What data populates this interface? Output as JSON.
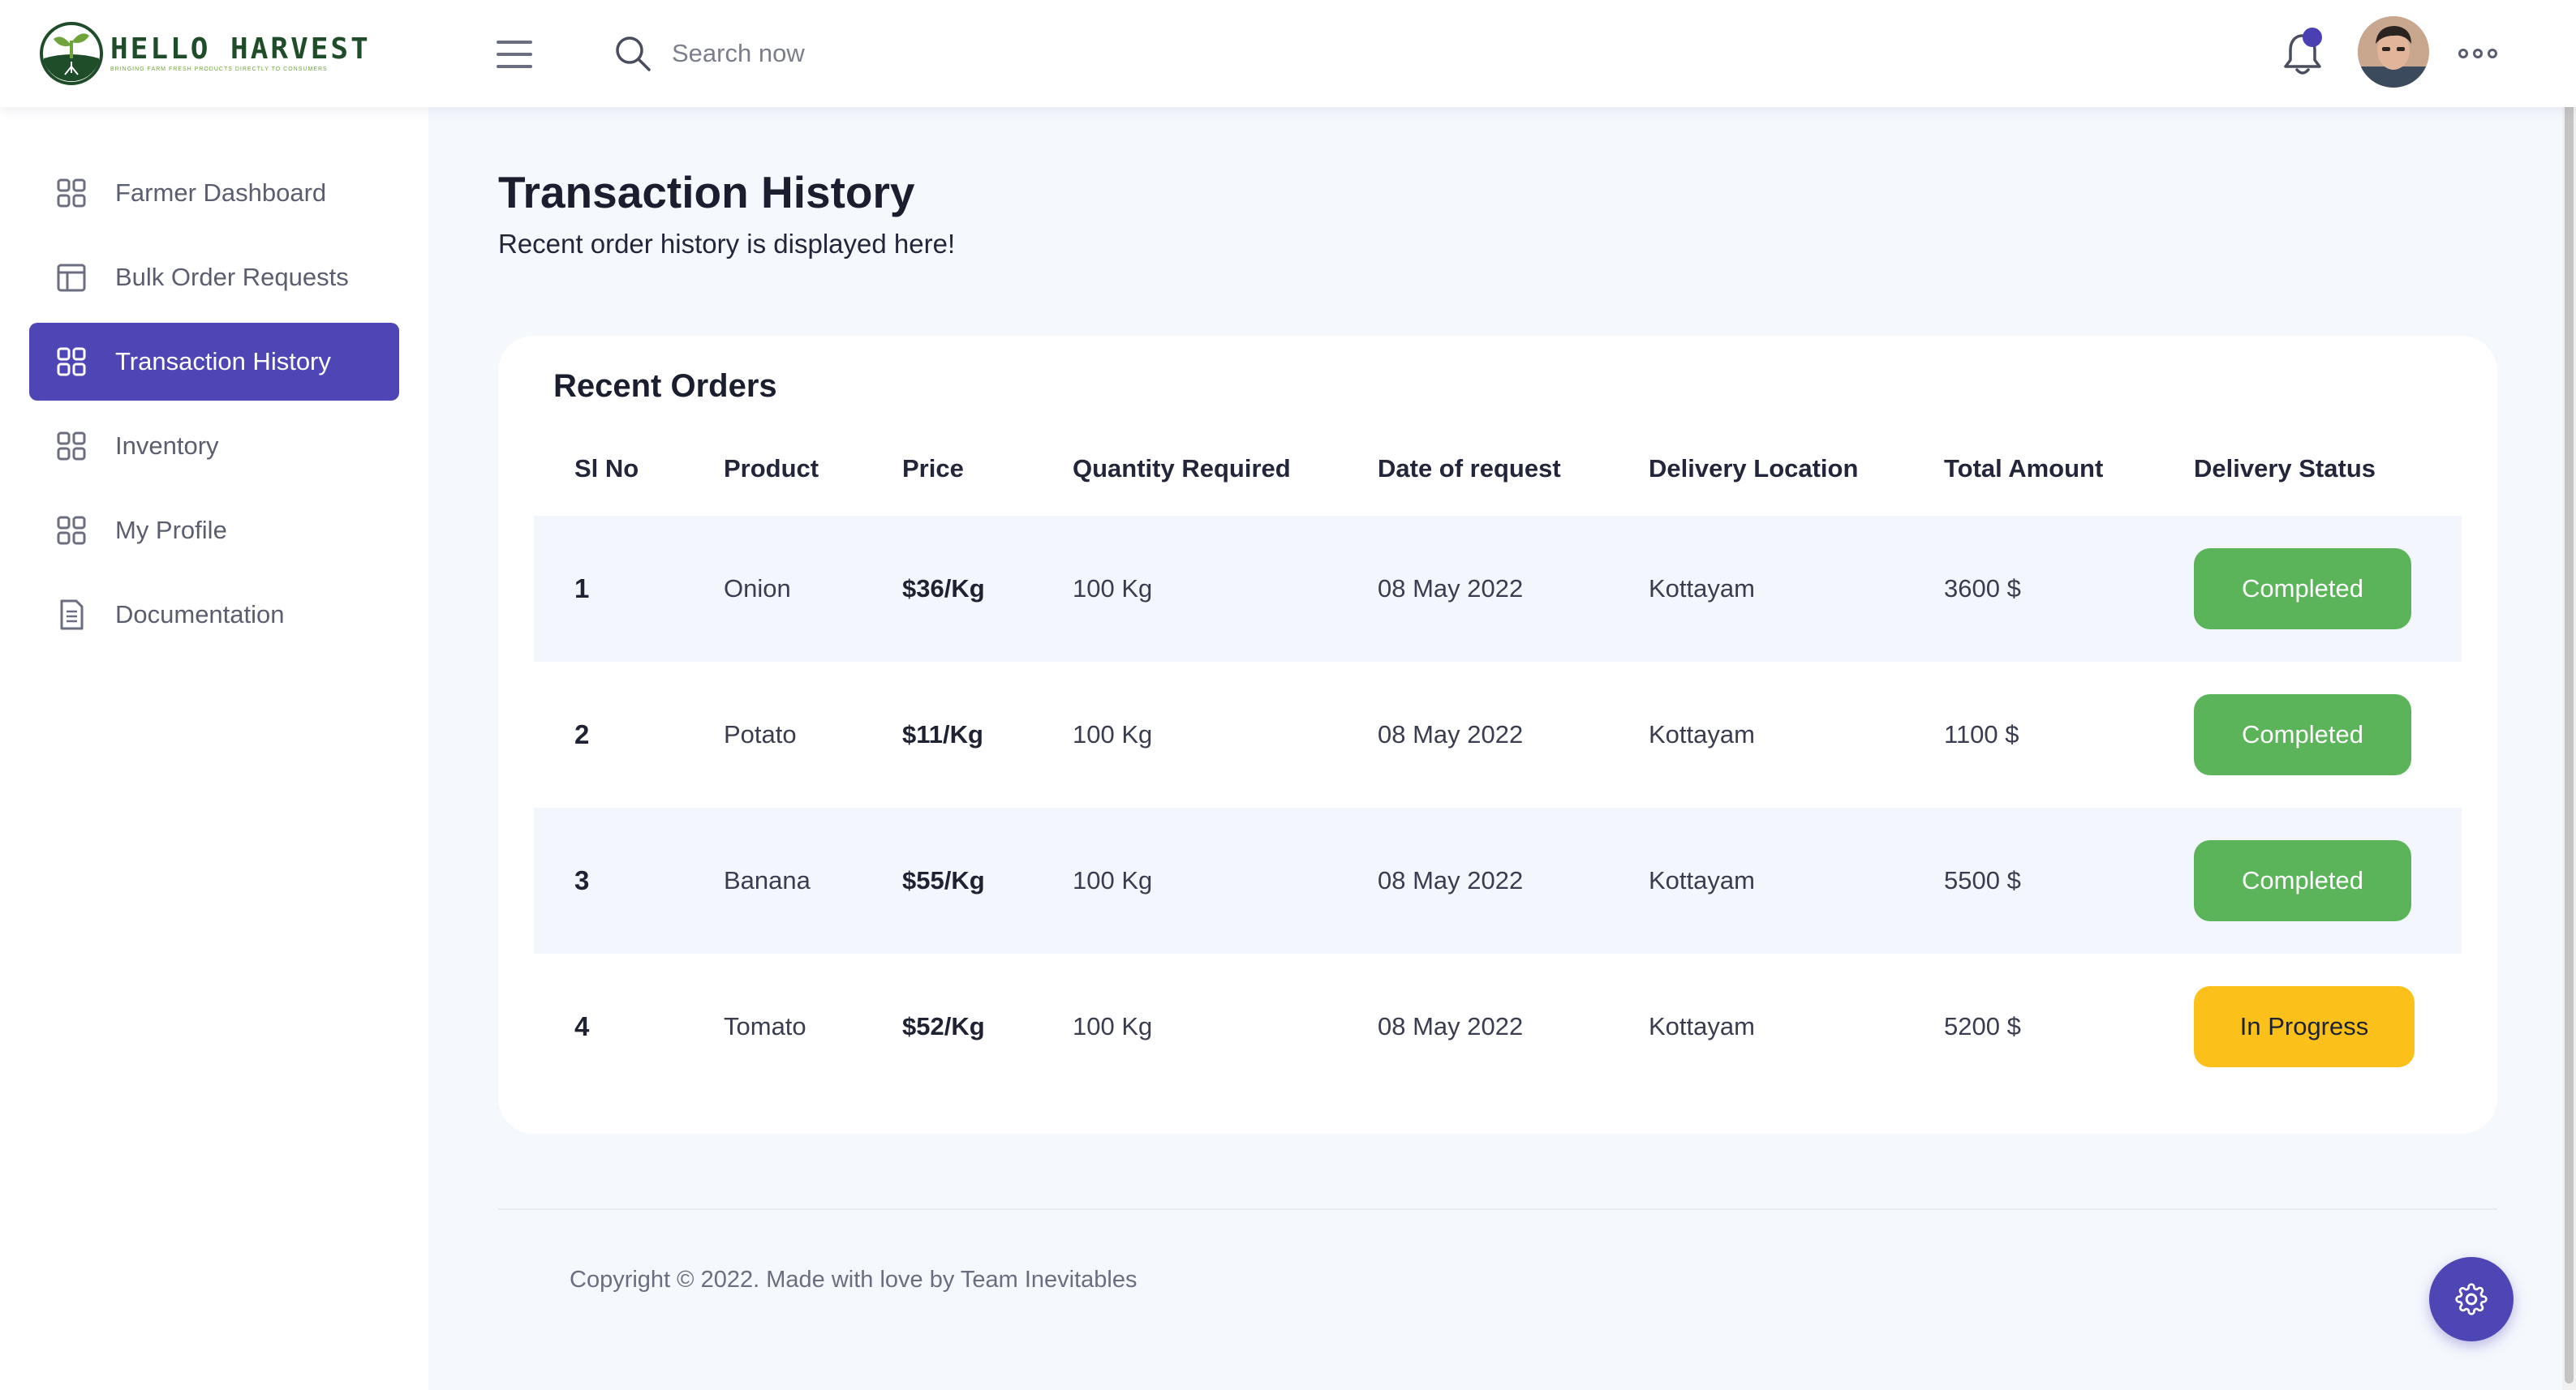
{
  "brand": {
    "name": "HELLO HARVEST",
    "tagline": "BRINGING FARM FRESH PRODUCTS DIRECTLY TO CONSUMERS",
    "colors": {
      "dark_green": "#1f4d2a",
      "leaf_green": "#6fa33c"
    }
  },
  "header": {
    "menu_icon": "hamburger-icon",
    "search": {
      "placeholder": "Search now",
      "value": "",
      "icon": "search-icon"
    },
    "notification_icon": "bell-icon",
    "notification_dot_color": "#4b3fb4",
    "more_icon": "more-dots-icon"
  },
  "sidebar": {
    "items": [
      {
        "label": "Farmer Dashboard",
        "icon": "grid-icon",
        "active": false
      },
      {
        "label": "Bulk Order Requests",
        "icon": "layout-icon",
        "active": false
      },
      {
        "label": "Transaction History",
        "icon": "grid-icon",
        "active": true
      },
      {
        "label": "Inventory",
        "icon": "grid-icon",
        "active": false
      },
      {
        "label": "My Profile",
        "icon": "grid-icon",
        "active": false
      },
      {
        "label": "Documentation",
        "icon": "document-icon",
        "active": false
      }
    ],
    "active_color": "#4f46b5"
  },
  "main": {
    "title": "Transaction History",
    "subtitle": "Recent order history is displayed here!"
  },
  "orders": {
    "title": "Recent Orders",
    "columns": [
      "Sl No",
      "Product",
      "Price",
      "Quantity Required",
      "Date of request",
      "Delivery Location",
      "Total Amount",
      "Delivery Status"
    ],
    "rows": [
      {
        "sl": "1",
        "product": "Onion",
        "price": "$36/Kg",
        "quantity": "100 Kg",
        "date": "08 May 2022",
        "location": "Kottayam",
        "total": "3600 $",
        "status": "Completed"
      },
      {
        "sl": "2",
        "product": "Potato",
        "price": "$11/Kg",
        "quantity": "100 Kg",
        "date": "08 May 2022",
        "location": "Kottayam",
        "total": "1100 $",
        "status": "Completed"
      },
      {
        "sl": "3",
        "product": "Banana",
        "price": "$55/Kg",
        "quantity": "100 Kg",
        "date": "08 May 2022",
        "location": "Kottayam",
        "total": "5500 $",
        "status": "Completed"
      },
      {
        "sl": "4",
        "product": "Tomato",
        "price": "$52/Kg",
        "quantity": "100 Kg",
        "date": "08 May 2022",
        "location": "Kottayam",
        "total": "5200 $",
        "status": "In Progress"
      }
    ],
    "status_colors": {
      "Completed": "#5bb459",
      "In Progress": "#fbc11a"
    }
  },
  "footer": {
    "text": "Copyright © 2022. Made with love by Team Inevitables"
  },
  "settings_icon": "gear-icon"
}
